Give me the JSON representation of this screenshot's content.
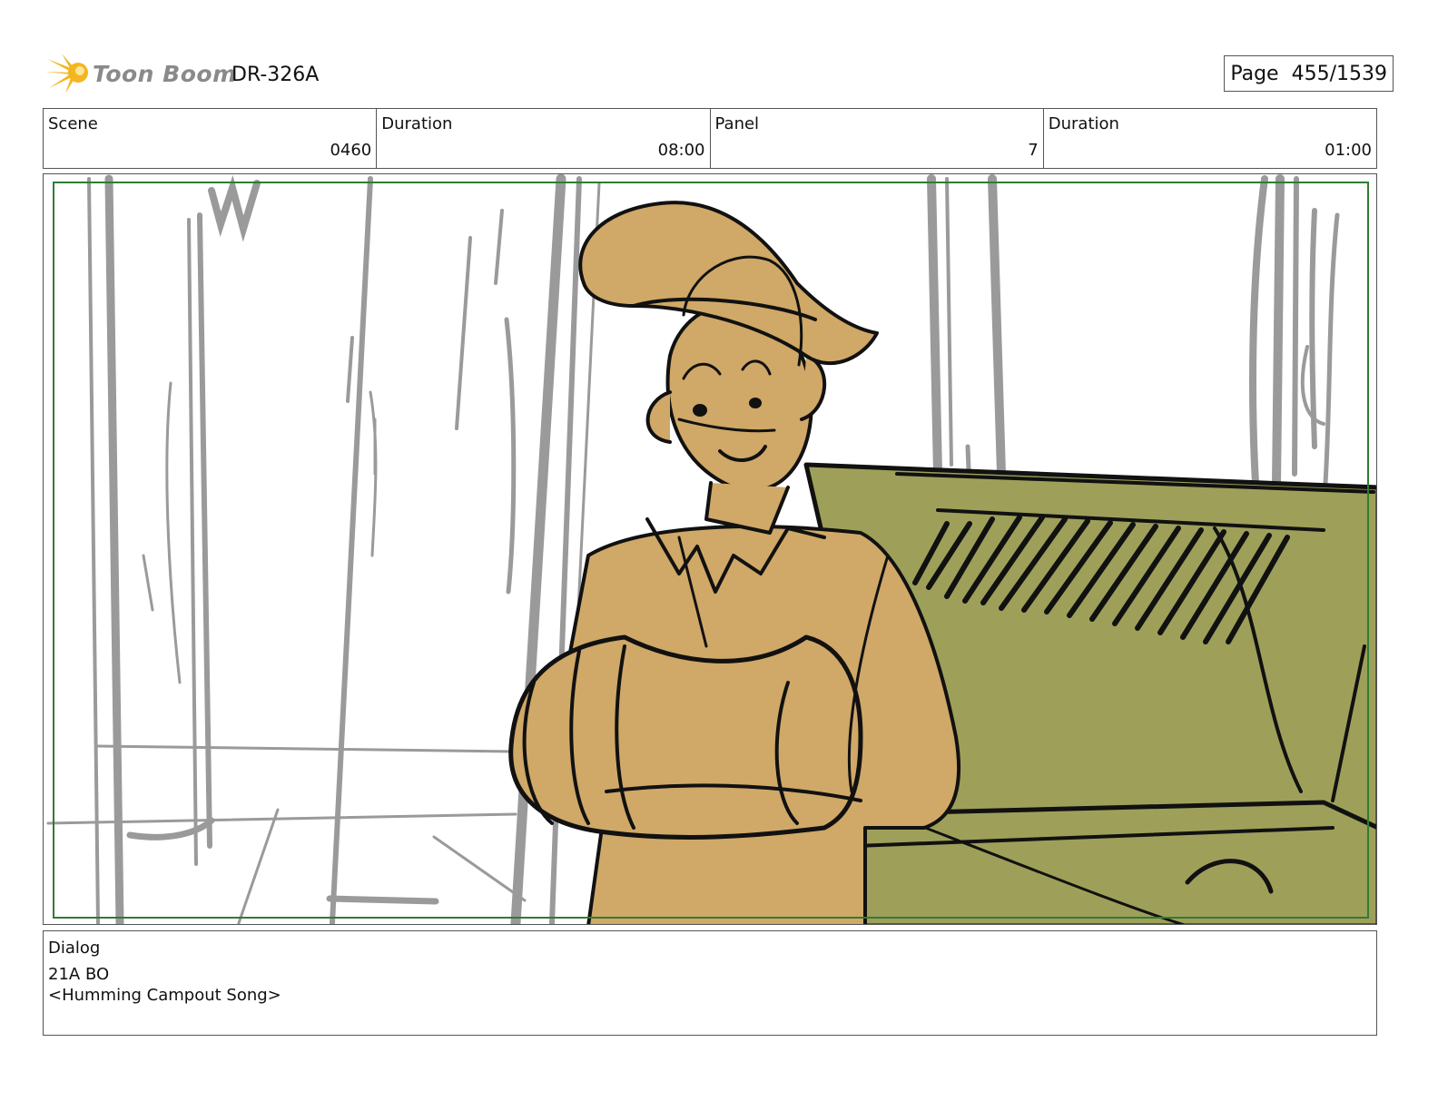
{
  "header": {
    "brand": "Toon Boom",
    "production_code": "DR-326A",
    "page_label": "Page",
    "page_value": "455/1539"
  },
  "info": {
    "scene_label": "Scene",
    "scene_value": "0460",
    "scene_duration_label": "Duration",
    "scene_duration_value": "08:00",
    "panel_label": "Panel",
    "panel_value": "7",
    "panel_duration_label": "Duration",
    "panel_duration_value": "01:00"
  },
  "colors": {
    "frame": "#2e7d32",
    "skin": "#d0a867",
    "tent": "#9ea05a",
    "pencil": "#9a9a9a",
    "ink": "#111111",
    "logo_flare": "#f3b61f"
  },
  "dialog": {
    "label": "Dialog",
    "lines": [
      "21A BO",
      "<Humming Campout Song>"
    ]
  }
}
